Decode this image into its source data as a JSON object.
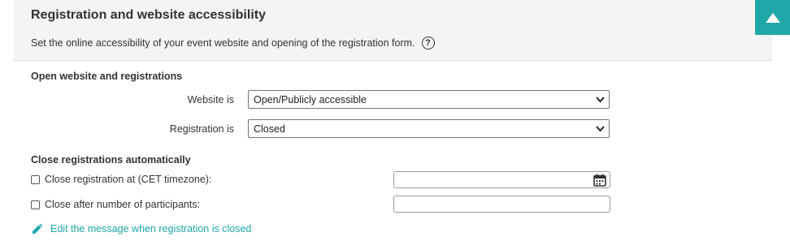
{
  "panel": {
    "title": "Registration and website accessibility",
    "subtitle": "Set the online accessibility of your event website and opening of the registration form.",
    "help_icon": "?",
    "collapse_icon": "triangle-up-icon",
    "accent_color": "#1fa8a8"
  },
  "open_section": {
    "heading": "Open website and registrations",
    "website_label": "Website is",
    "website_value": "Open/Publicly accessible",
    "registration_label": "Registration is",
    "registration_value": "Closed"
  },
  "close_section": {
    "heading": "Close registrations automatically",
    "close_at_label": "Close registration at (CET timezone):",
    "close_at_value": "",
    "close_after_label": "Close after number of participants:",
    "close_after_value": ""
  },
  "edit_link": {
    "label": "Edit the message when registration is closed"
  }
}
